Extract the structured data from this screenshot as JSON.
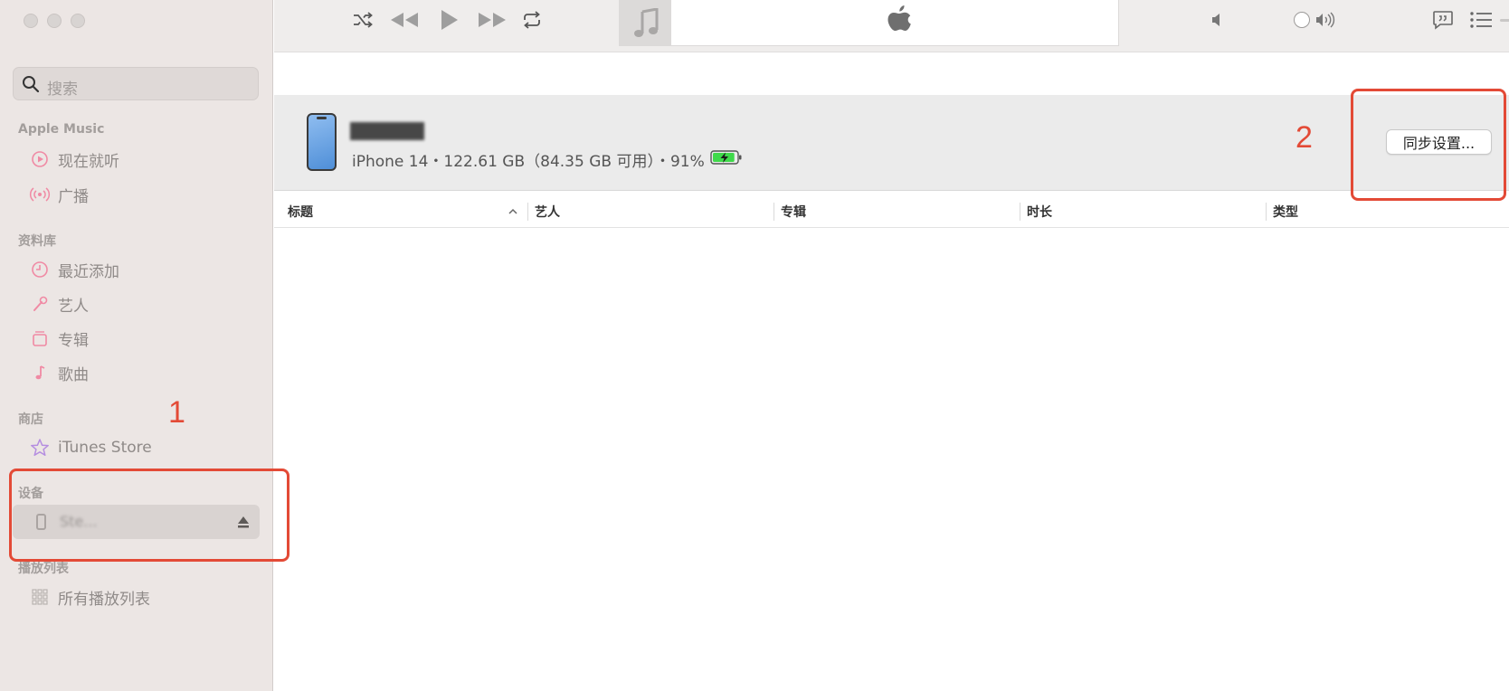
{
  "sidebar": {
    "search_placeholder": "搜索",
    "sections": {
      "apple_music": "Apple Music",
      "library": "资料库",
      "store": "商店",
      "devices": "设备",
      "playlists": "播放列表"
    },
    "items": {
      "listen_now": "现在就听",
      "radio": "广播",
      "recently_added": "最近添加",
      "artists": "艺人",
      "albums": "专辑",
      "songs": "歌曲",
      "itunes_store": "iTunes Store",
      "all_playlists": "所有播放列表"
    },
    "device_name": "Ste..."
  },
  "device": {
    "info": "iPhone 14・122.61 GB（84.35 GB 可用）・91%",
    "battery_percent": 91,
    "sync_button": "同步设置..."
  },
  "table": {
    "columns": [
      "标题",
      "艺人",
      "专辑",
      "时长",
      "类型"
    ]
  },
  "annotations": [
    "1",
    "2"
  ],
  "colors": {
    "annotation": "#e34a36",
    "battery": "#3fd94a",
    "icon_pink": "#f08aa4",
    "star": "#b58ee0"
  }
}
